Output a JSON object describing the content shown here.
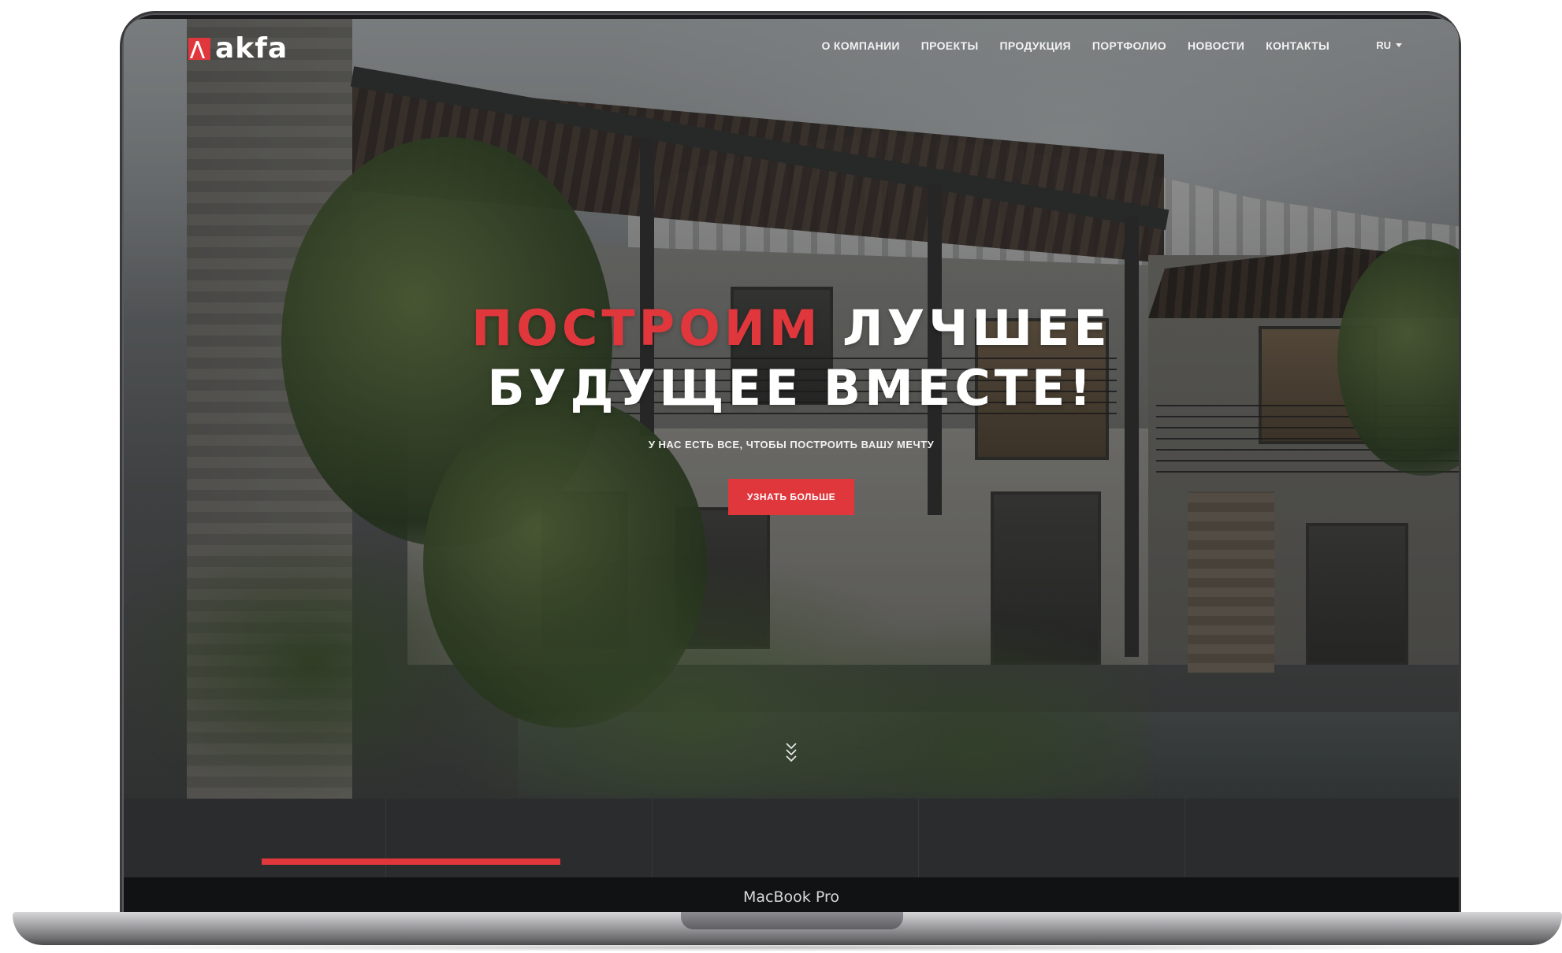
{
  "device": {
    "label": "MacBook Pro"
  },
  "logo": {
    "text": "akfa",
    "icon": "akfa-logo-icon"
  },
  "nav": {
    "items": [
      {
        "label": "О КОМПАНИИ"
      },
      {
        "label": "ПРОЕКТЫ"
      },
      {
        "label": "ПРОДУКЦИЯ"
      },
      {
        "label": "ПОРТФОЛИО"
      },
      {
        "label": "НОВОСТИ"
      },
      {
        "label": "КОНТАКТЫ"
      }
    ],
    "language": "RU"
  },
  "hero": {
    "headline_accent": "ПОСТРОИМ",
    "headline_rest_1": " ЛУЧШЕЕ",
    "headline_line_2": "БУДУЩЕЕ ВМЕСТЕ!",
    "subheadline": "У НАС ЕСТЬ ВСЕ, ЧТОБЫ ПОСТРОИТЬ ВАШУ МЕЧТУ",
    "cta_label": "УЗНАТЬ БОЛЬШЕ"
  },
  "slider": {
    "progress_fraction": 0.28
  },
  "colors": {
    "accent": "#e0373d",
    "text_light": "#ffffff",
    "band_dark": "#2b2c2e"
  }
}
